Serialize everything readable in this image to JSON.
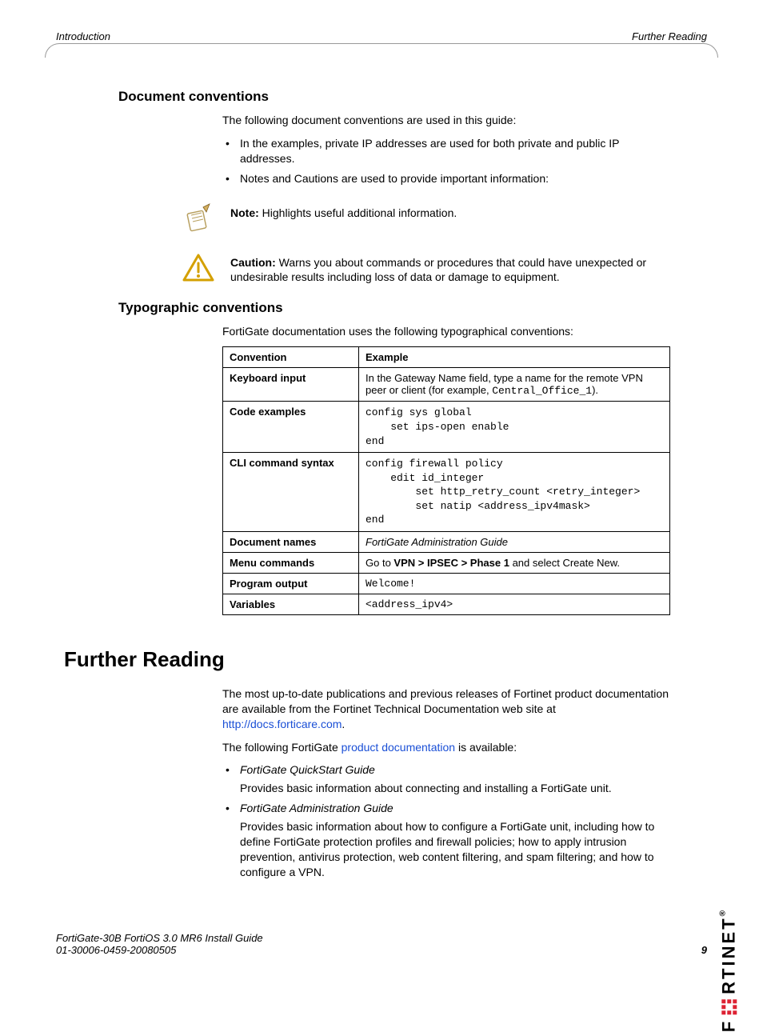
{
  "header": {
    "left": "Introduction",
    "right": "Further Reading"
  },
  "s1": {
    "title": "Document conventions",
    "intro": "The following document conventions are used in this guide:",
    "b1": "In the examples, private IP addresses are used for both private and public IP addresses.",
    "b2": "Notes and Cautions are used to provide important information:"
  },
  "note": {
    "label": "Note:",
    "text": " Highlights useful additional information."
  },
  "caution": {
    "label": "Caution:",
    "text": " Warns you about commands or procedures that could have unexpected or undesirable results including loss of data or damage to equipment."
  },
  "s2": {
    "title": "Typographic conventions",
    "intro": "FortiGate documentation uses the following typographical conventions:",
    "th1": "Convention",
    "th2": "Example",
    "r1c1": "Keyboard input",
    "r1c2a": "In the Gateway Name field, type a name for the remote VPN peer or client (for example, ",
    "r1c2b": "Central_Office_1",
    "r1c2c": ").",
    "r2c1": "Code examples",
    "r2c2": "config sys global\n    set ips-open enable\nend",
    "r3c1": "CLI command syntax",
    "r3c2": "config firewall policy\n    edit id_integer\n        set http_retry_count <retry_integer>\n        set natip <address_ipv4mask>\nend",
    "r4c1": "Document names",
    "r4c2": "FortiGate Administration Guide",
    "r5c1": "Menu commands",
    "r5c2a": "Go to ",
    "r5c2b": "VPN > IPSEC > Phase 1",
    "r5c2c": " and select Create New.",
    "r6c1": "Program output",
    "r6c2": "Welcome!",
    "r7c1": "Variables",
    "r7c2": "<address_ipv4>"
  },
  "s3": {
    "title": "Further Reading",
    "p1a": "The most up-to-date publications and previous releases of Fortinet product documentation are available from the Fortinet Technical Documentation web site at ",
    "p1link": "http://docs.forticare.com",
    "p1b": ".",
    "p2a": "The following FortiGate ",
    "p2link": "product documentation",
    "p2b": " is available:",
    "li1": "FortiGate QuickStart Guide",
    "li1sub": "Provides basic information about connecting and installing a FortiGate unit.",
    "li2": "FortiGate Administration Guide",
    "li2sub": "Provides basic information about how to configure a FortiGate unit, including how to define FortiGate protection profiles and firewall policies; how to apply intrusion prevention, antivirus protection, web content filtering, and spam filtering; and how to configure a VPN."
  },
  "footer": {
    "l1": "FortiGate-30B FortiOS 3.0 MR6 Install Guide",
    "l2": "01-30006-0459-20080505",
    "page": "9"
  },
  "logo": "F    RTINET"
}
